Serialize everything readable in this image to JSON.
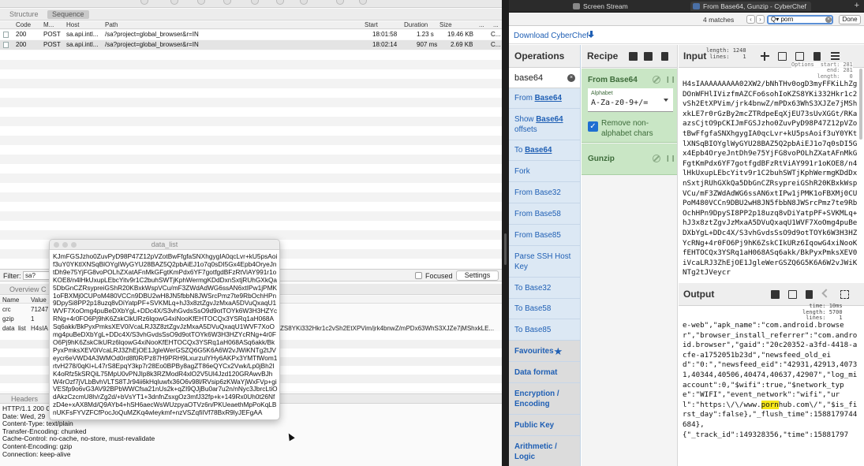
{
  "proxy": {
    "tabs": [
      "Structure",
      "Sequence"
    ],
    "columns": [
      "Code",
      "M...",
      "Host",
      "Path",
      "Start",
      "Duration",
      "Size",
      "...",
      "..."
    ],
    "rows": [
      {
        "code": "200",
        "method": "POST",
        "host": "sa.api.intl...",
        "path": "/sa?project=global_browser&r=IN",
        "start": "18:01:58",
        "duration": "1.23 s",
        "size": "19.46 KB",
        "extra": "C..."
      },
      {
        "code": "200",
        "method": "POST",
        "host": "sa.api.intl...",
        "path": "/sa?project=global_browser&r=IN",
        "start": "18:02:14",
        "duration": "907 ms",
        "size": "2.69 KB",
        "extra": "C..."
      }
    ],
    "filter_label": "Filter:",
    "filter_value": "sa?",
    "focused_label": "Focused",
    "settings_label": "Settings",
    "subtabs": [
      "Overview",
      "C"
    ],
    "nv_columns": [
      "Name",
      "Value"
    ],
    "nv_rows": [
      {
        "name": "crc",
        "value": "71247"
      },
      {
        "name": "gzip",
        "value": "1"
      },
      {
        "name": "data_list",
        "value": "H4sIA",
        "tail": "ZS8YKi332Hkr1c2vSh2EtXPVim/jrk4bnwZ/mPDx63WhS3XJZe7jMShxkLE..."
      }
    ],
    "headers_tab": "Headers",
    "response_headers": [
      "HTTP/1.1 200 C",
      "Date: Wed, 29",
      "Content-Type: text/plain",
      "Transfer-Encoding: chunked",
      "Cache-Control: no-cache, no-store, must-revalidate",
      "Content-Encoding: gzip",
      "Connection: keep-alive"
    ]
  },
  "data_list_window": {
    "title": "data_list",
    "text": "KJmFGSJzho0ZuvPyD98P47Z12pVZotBwFfgfaSNXhgygIA0qcLvr+kU5psAoif3uY0YKtlXNSqBlOYgIWyGYU28BAZ5Q2pbAiEJ1o7q0sDI5Gx4Epb4OryeJntDh9e75YjFG8voPOLhZXatAFnMkGFgtKmPdx6YF7gotfgdBFzRtViAY991r1oKOE8/n4lHkUxupLEbcYitv9r1C2buhSWTjKphWermgKDdDxnSxtjRUhGXkQa5DbGnCZRsypreiGShR20KBxkWspVCu/mF3ZWdAdWG6ssAN6xtIPw1jPMK1oFBXMj0CUPoM480VCCn9DBU2wH8JN5fbbN8JWSrcPmz7te9RbOchHPn9DpySi8PP2p18uzq8vDiYatpPF+SVKMLq+hJ3x8ztZgvJzMxaA5DVuQxaqU1WVF7XoOmg4puBeDXbYgL+DDc4X/S3vhGvdsSsO9d9otTOYk6W3H3HZYcRNg+4r0FO6Pj9hK6ZskClkURz6lqowG4xiNooKfEHTOCQx3YSRq1aH068ASq6akk/BkPyxPmksXEV0iVcaLRJ3Z8ztZgvJzMxaA5DVuQxaqU1WVF7XoOmg4puBeDXbYgL+DDc4X/S3vhGvdsSsO9d9otTOYk6W3H3HZYcRNg+4r0FO6Pj9hK6ZskClkURz6lqowG4xiNooKfEHTOCQx3YSRq1aH068ASq6akk/BkPyxPmksXEV0iVcaLRJ3ZhEjOE1JgleWerGSZQ6G5K6A6W2vJWiKNTg2tJVeycr6eVWD4A3WMOd0rd8f0R/Pz87H9PRH9LxurzulYHy6AKPx3YMTfWom1rtvH278/0qKl+L47rS8EpqY3kp7r28Eo0BPBy8agZT86eQYCx2Vwk/Lp0jBh2IK4oRfz5kSRQiL75MpU0vPNJIp8k3RZModR4xlO2V5Ul4Jzd120GRAwvBJhW4rOzf7jVLbBvhVLTS8TJr94ii6kHqluwfx36O6v98l/RVsip6zKWaYjWxFVp+giVESfp9o6vG3AV92BPbWWCfsa21nUs2k+qZI9QJjBu0ar7u2n/nNyc3JbrcLtiOdAkzCzcmU8h/rZg2d/+bVsYT1+3dnfnZsxgOz3mfJ32fp+k+149Rx0Uh0t26NfzD4e+xAX8Md/Q9AYb4+hSH6aecWsWUzpyaOTVz6n/PKUeaethMpPoKqLBnUKFsFYVZFCfPocJoQuMZKq4wleykmf+nzVSZqfiIVf78BxR9lyJEFgAA"
  },
  "browser": {
    "tabs": [
      "Screen Stream",
      "From Base64, Gunzip - CyberChef"
    ],
    "find": {
      "count": "4 matches",
      "query": "porn",
      "done": "Done"
    }
  },
  "cyberchef": {
    "download_label": "Download CyberChef",
    "operations_title": "Operations",
    "search_value": "base64",
    "operations": [
      {
        "pre": "From ",
        "hl": "Base64",
        "post": "",
        "h": 26
      },
      {
        "pre": "Show ",
        "hl": "Base64",
        "post": " offsets",
        "h": 40
      },
      {
        "pre": "To ",
        "hl": "Base64",
        "post": "",
        "h": 26
      },
      {
        "pre": "Fork",
        "hl": "",
        "post": "",
        "h": 27
      },
      {
        "pre": "From Base32",
        "hl": "",
        "post": "",
        "h": 27
      },
      {
        "pre": "From Base58",
        "hl": "",
        "post": "",
        "h": 27
      },
      {
        "pre": "From Base85",
        "hl": "",
        "post": "",
        "h": 27
      },
      {
        "pre": "Parse SSH Host Key",
        "hl": "",
        "post": "",
        "h": 40
      },
      {
        "pre": "To Base32",
        "hl": "",
        "post": "",
        "h": 27
      },
      {
        "pre": "To Base58",
        "hl": "",
        "post": "",
        "h": 26
      },
      {
        "pre": "To Base85",
        "hl": "",
        "post": "",
        "h": 27
      }
    ],
    "categories": [
      {
        "label": "Favourites",
        "h": 27
      },
      {
        "label": "Data format",
        "h": 27
      },
      {
        "label": "Encryption / Encoding",
        "h": 40
      },
      {
        "label": "Public Key",
        "h": 27
      },
      {
        "label": "Arithmetic / Logic",
        "h": 40
      }
    ],
    "recipe_title": "Recipe",
    "steps": [
      "From Base64",
      "Gunzip"
    ],
    "alphabet_label": "Alphabet",
    "alphabet_value": "A-Za-z0-9+/=",
    "remove_label": "Remove non-alphabet chars",
    "input_title": "Input",
    "input_stats": "length: 1248\n lines:    1",
    "input_overlay": "Options  start: 281\n           end: 281\n        length:   0",
    "input_text": "H4sIAAAAAAAAA02XW2/bNhTHv0ogD3myFFKiLhZgDOnWFHlIVizfmAZCFo6sohIoKZS8YKi332Hkr1c2vSh2EtXPVim/jrk4bnwZ/mPDx63WhS3XJZe7jMShxkLE7r0rGzBy2mcZTRdpeEqXjEU73sUvXGGt/RKaazsCjtO9pCKIJmFGSJzho0ZuvPyD98P47Z12pVZotBwFfgfaSNXhgygIA0qcLvr+kU5psAoif3uY0YKtlXNSqBIOYglWyGYU28BAZ5Q2pbAiEJ1o7q0sDI5Gx4Epb4OryeJntDh9e75YjFG8voPOLhZXatAFnMkGFgtKmPdx6YF7gotfgdBFzRtViAY991r1oKOE8/n4lHkUxupLEbcYitv9r1C2buhSWTjKphWermgKDdDxnSxtjRUhGXkQa5DbGnCZRsypreiGShR20KBxkWspVCu/mF3ZWdAdWG6ssAN6xtIPw1jPMK1oFBXMj0CUPoM480VCCn9DBU2wH8JN5fbbN8JWSrcPmz7te9RbOchHPn9DpySI8PP2p18uzq8vDiYatpPF+SVKMLq+hJ3x8ztZgvJzMxaA5DVuQxaqU1WVF7XoOmg4puBeDXbYgL+DDc4X/S3vhGvdsSsO9d9otTOYk6W3H3HZYcRNg+4r0FO6Pj9hK6ZskCIkURz6IqowG4xiNooKfEHTOCQx3YSRq1aH068ASq6akk/BkPyxPmksXEV0iVcaLRJ3ZhEjOE1JgleWerGSZQ6G5K6A6W2vJWiKNTg2tJVeycr",
    "output_title": "Output",
    "output_stats": "  time: 10ms\nlength: 5700\n lines:    1",
    "output_pre": "e-web\",\"apk_name\":\"com.android.browser\",\"browser_install_referrer\":\"com.android.browser\",\"gaid\":\"20c20352-a3fd-4418-acfe-a1752051b23d\",\"newsfeed_old_eid\":\"0:\",\"newsfeed_eid\":\"42931,42913,40731,40344,40506,40474,40637,42907\",\"log_miaccount\":0,\"$wifi\":true,\"$network_type\":\"WIFI\",\"event_network\":\"wifi\",\"url\":\"https:\\/\\/www.",
    "output_hl": "porn",
    "output_post": "hub.com\\/\",\"$is_first_day\":false},\"_flush_time\":1588179744684},\n{\"_track_id\":149328356,\"time\":15881797"
  }
}
